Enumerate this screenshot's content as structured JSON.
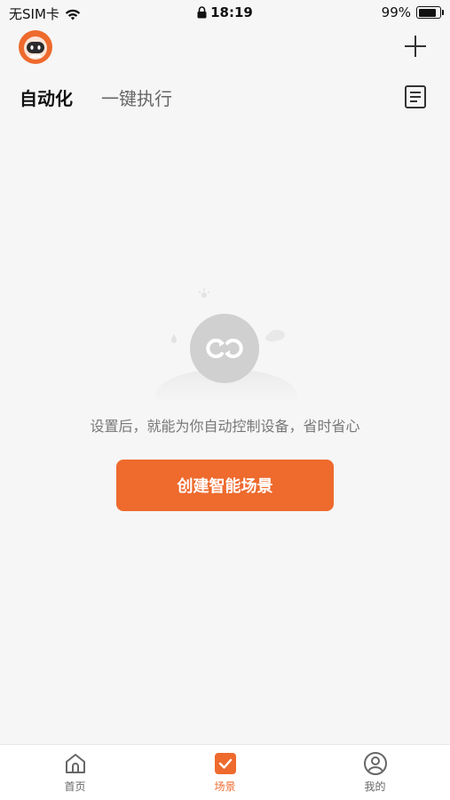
{
  "status_bar": {
    "carrier": "无SIM卡",
    "time": "18:19",
    "battery": "99%",
    "battery_level": 0.99
  },
  "header": {
    "tabs": [
      {
        "label": "自动化",
        "active": true
      },
      {
        "label": "一键执行",
        "active": false
      }
    ]
  },
  "empty_state": {
    "message": "设置后，就能为你自动控制设备，省时省心",
    "button_label": "创建智能场景"
  },
  "bottom_nav": {
    "items": [
      {
        "label": "首页",
        "icon": "home-icon",
        "active": false
      },
      {
        "label": "场景",
        "icon": "scene-check-icon",
        "active": true
      },
      {
        "label": "我的",
        "icon": "profile-icon",
        "active": false
      }
    ]
  },
  "colors": {
    "accent": "#ee6a2d",
    "background": "#f6f6f6"
  }
}
